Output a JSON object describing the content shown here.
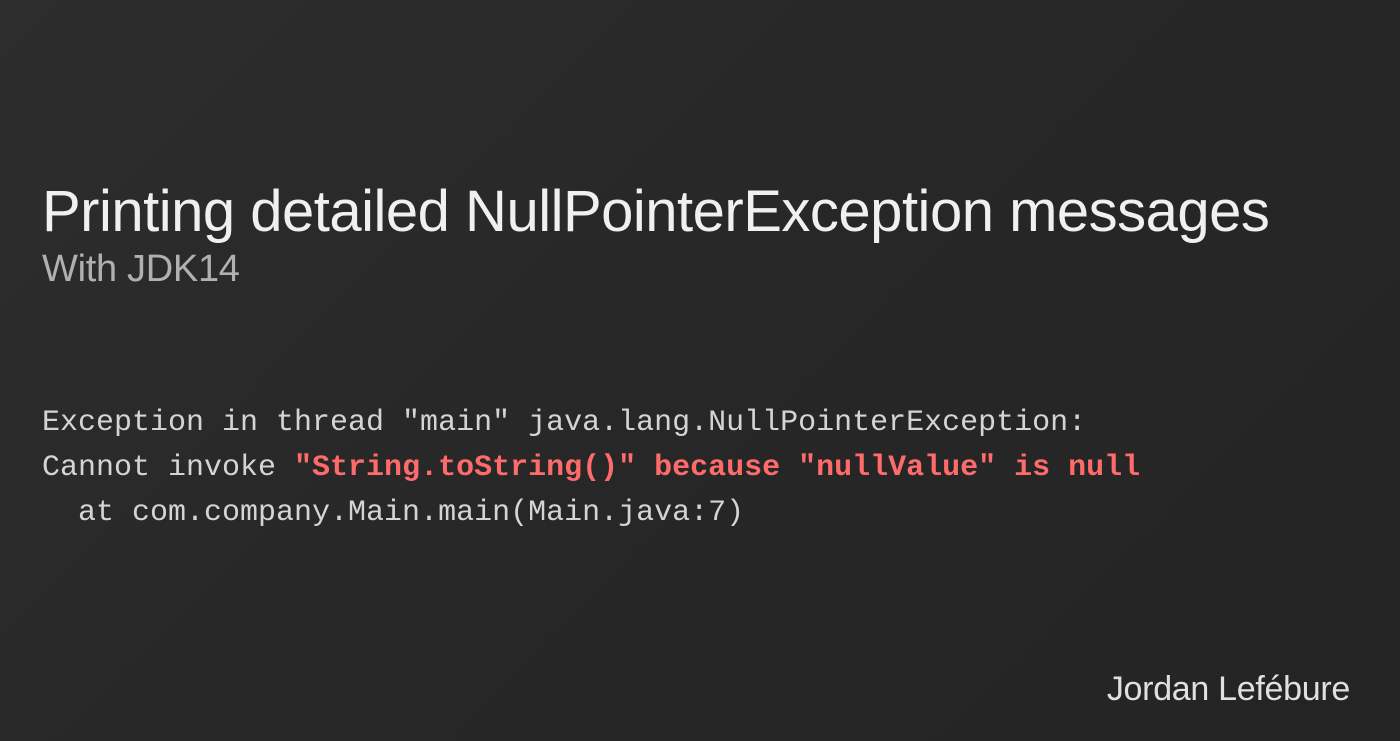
{
  "header": {
    "title": "Printing detailed NullPointerException messages",
    "subtitle": "With JDK14"
  },
  "code": {
    "line1_prefix": "Exception in thread \"main\" java.lang.NullPointerException:",
    "line2_prefix": "Cannot invoke ",
    "line2_highlight": "\"String.toString()\" because \"nullValue\" is null",
    "line3": "  at com.company.Main.main(Main.java:7)"
  },
  "author": "Jordan Lefébure"
}
